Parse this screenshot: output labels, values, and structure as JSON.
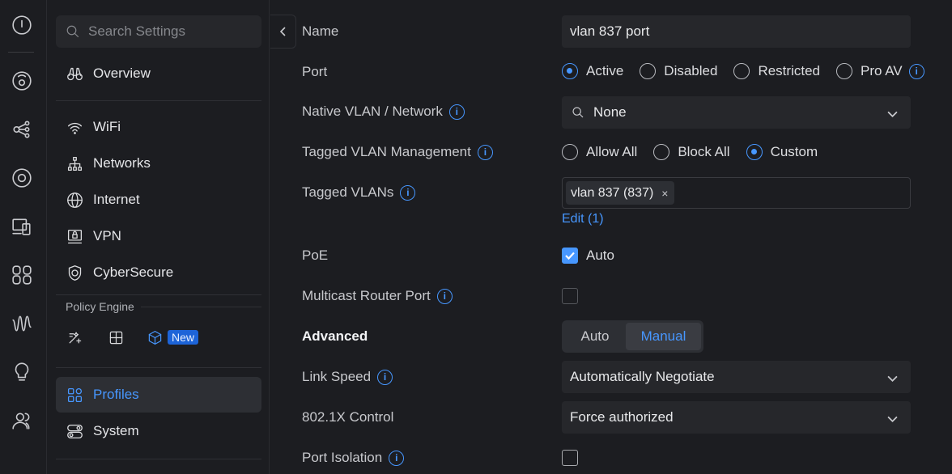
{
  "rail": {
    "icons": [
      "info-circle-icon",
      "dashboard-icon",
      "topology-icon",
      "target-icon",
      "devices-icon",
      "clients-icon",
      "insights-icon",
      "lightbulb-icon",
      "admins-icon"
    ]
  },
  "sidebar": {
    "search_placeholder": "Search Settings",
    "overview": "Overview",
    "items": [
      {
        "label": "WiFi"
      },
      {
        "label": "Networks"
      },
      {
        "label": "Internet"
      },
      {
        "label": "VPN"
      },
      {
        "label": "CyberSecure"
      }
    ],
    "policy_engine_label": "Policy Engine",
    "new_badge": "New",
    "profiles": "Profiles",
    "system": "System"
  },
  "form": {
    "name_label": "Name",
    "name_value": "vlan 837 port",
    "port_label": "Port",
    "port_options": [
      "Active",
      "Disabled",
      "Restricted",
      "Pro AV"
    ],
    "port_selected": "Active",
    "native_vlan_label": "Native VLAN / Network",
    "native_vlan_value": "None",
    "tagged_mgmt_label": "Tagged VLAN Management",
    "tagged_mgmt_options": [
      "Allow All",
      "Block All",
      "Custom"
    ],
    "tagged_mgmt_selected": "Custom",
    "tagged_vlans_label": "Tagged VLANs",
    "tagged_vlans_chip": "vlan 837 (837)",
    "chip_remove": "×",
    "edit_link": "Edit (1)",
    "poe_label": "PoE",
    "poe_value": "Auto",
    "poe_checked": true,
    "multicast_label": "Multicast Router Port",
    "multicast_checked": false,
    "advanced_label": "Advanced",
    "advanced_options": [
      "Auto",
      "Manual"
    ],
    "advanced_selected": "Manual",
    "link_speed_label": "Link Speed",
    "link_speed_value": "Automatically Negotiate",
    "dot1x_label": "802.1X Control",
    "dot1x_value": "Force authorized",
    "port_isolation_label": "Port Isolation",
    "port_isolation_checked": false,
    "info_glyph": "i"
  },
  "colors": {
    "accent": "#4797ff",
    "background": "#1c1d21",
    "field_bg": "#26272b",
    "badge_bg": "#1d64d8"
  }
}
